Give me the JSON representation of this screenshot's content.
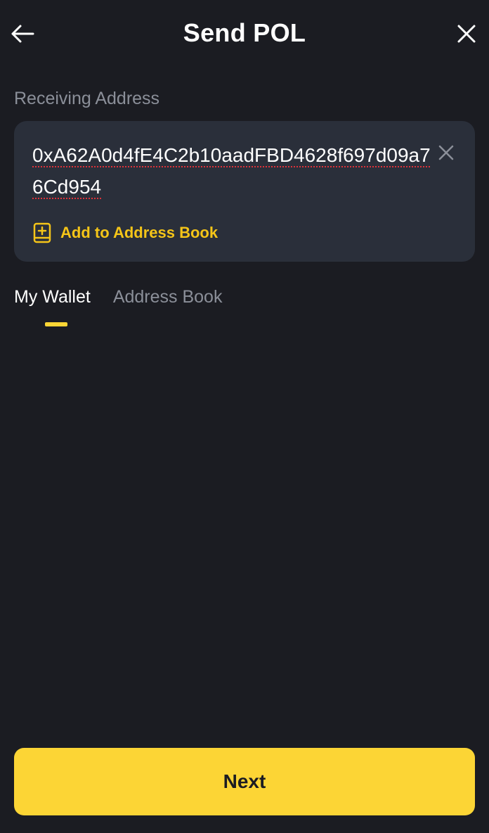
{
  "header": {
    "title": "Send POL",
    "back_icon": "arrow-left-icon",
    "close_icon": "close-icon"
  },
  "receiving": {
    "label": "Receiving Address",
    "address": "0xA62A0d4fE4C2b10aadFBD4628f697d09a76Cd954",
    "clear_icon": "clear-icon",
    "add_book_icon": "address-book-plus-icon",
    "add_book_label": "Add to Address Book"
  },
  "tabs": [
    {
      "label": "My Wallet",
      "active": true
    },
    {
      "label": "Address Book",
      "active": false
    }
  ],
  "footer": {
    "next_label": "Next"
  },
  "colors": {
    "background": "#1b1c22",
    "card": "#2a2f3a",
    "accent": "#fcd535",
    "muted_text": "#8b8f99"
  }
}
